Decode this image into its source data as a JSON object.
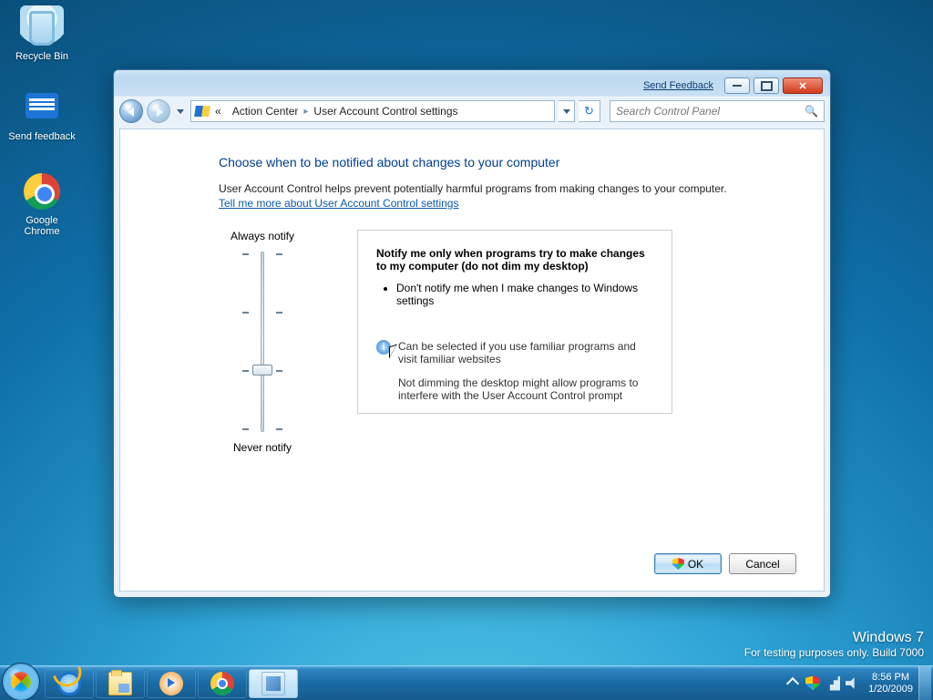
{
  "desktop": {
    "icons": [
      {
        "name": "recycle-bin",
        "label": "Recycle Bin"
      },
      {
        "name": "send-feedback",
        "label": "Send feedback"
      },
      {
        "name": "google-chrome",
        "label": "Google Chrome"
      }
    ],
    "watermark_line1": "Windows  7",
    "watermark_line2": "For testing purposes only. Build 7000"
  },
  "taskbar": {
    "clock_time": "8:56 PM",
    "clock_date": "1/20/2009"
  },
  "window": {
    "feedback_link": "Send Feedback",
    "breadcrumb": {
      "overflow": "«",
      "seg1": "Action Center",
      "seg2": "User Account Control settings"
    },
    "search_placeholder": "Search Control Panel",
    "heading": "Choose when to be notified about changes to your computer",
    "description": "User Account Control helps prevent potentially harmful programs from making changes to your computer.",
    "help_link": "Tell me more about User Account Control settings",
    "slider_top": "Always notify",
    "slider_bottom": "Never notify",
    "panel_title": "Notify me only when programs try to make changes to my computer (do not dim my desktop)",
    "panel_bullet": "Don't notify me when I make changes to Windows settings",
    "info1": "Can be selected if you use familiar programs and visit familiar websites",
    "info2": "Not dimming the desktop might allow programs to interfere with the User Account Control prompt",
    "ok_label": "OK",
    "cancel_label": "Cancel"
  }
}
